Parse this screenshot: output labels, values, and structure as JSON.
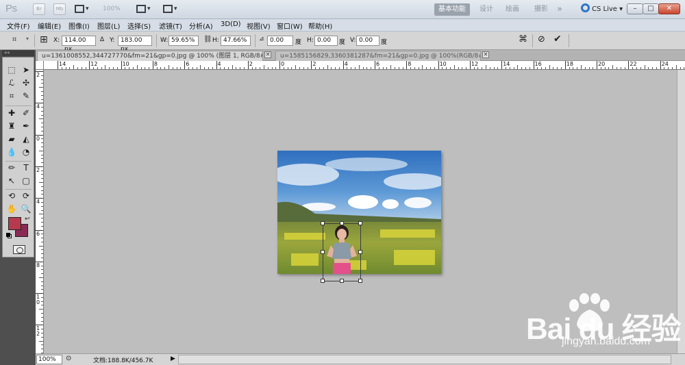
{
  "app": {
    "logo": "Ps",
    "zoom_label": "100%",
    "tb_icon_a": "Br",
    "tb_icon_b": "Mb",
    "workspaces": [
      "基本功能",
      "设计",
      "绘画",
      "摄影"
    ],
    "more_label": "»",
    "cs_live": "CS Live",
    "window_buttons": [
      "–",
      "□",
      "✕"
    ],
    "accent_color": "#9aa3ad",
    "close_color": "#c8462e"
  },
  "menu": [
    "文件(F)",
    "编辑(E)",
    "图像(I)",
    "图层(L)",
    "选择(S)",
    "滤镜(T)",
    "分析(A)",
    "3D(D)",
    "视图(V)",
    "窗口(W)",
    "帮助(H)"
  ],
  "options": {
    "x_label": "X:",
    "x_value": "114.00 px",
    "y_label": "Y:",
    "y_value": "183.00 px",
    "w_label": "W:",
    "w_value": "59.65%",
    "h_label": "H:",
    "h_value": "47.66%",
    "angle_value": "0.00",
    "angle_unit": "度",
    "hskew_label": "H:",
    "hskew_value": "0.00",
    "hskew_unit": "度",
    "vskew_label": "V:",
    "vskew_value": "0.00",
    "vskew_unit": "度"
  },
  "tabs": [
    {
      "label": "u=1361008552,344727770&fm=21&gp=0.jpg @ 100% (图层 1, RGB/8#) *",
      "active": true
    },
    {
      "label": "u=1585156829,3360381287&fm=21&gp=0.jpg @ 100%(RGB/8#)",
      "active": false
    }
  ],
  "tools_header": "««",
  "colors": {
    "foreground": "#b63a4e",
    "background": "#8a2b55"
  },
  "ruler_top": [
    "14",
    "12",
    "10",
    "8",
    "6",
    "4",
    "2",
    "0",
    "2",
    "4",
    "6",
    "8",
    "10",
    "12",
    "14",
    "16",
    "18",
    "20",
    "22",
    "24"
  ],
  "ruler_left": [
    "2",
    "4",
    "0",
    "2",
    "4",
    "6",
    "8",
    "1 0",
    "1 2"
  ],
  "status": {
    "zoom": "100%",
    "doc": "文档:188.8K/456.7K",
    "arrow": "▶"
  },
  "watermark": {
    "text": "Bai du 经验",
    "url": "jingyan.baidu.com"
  }
}
